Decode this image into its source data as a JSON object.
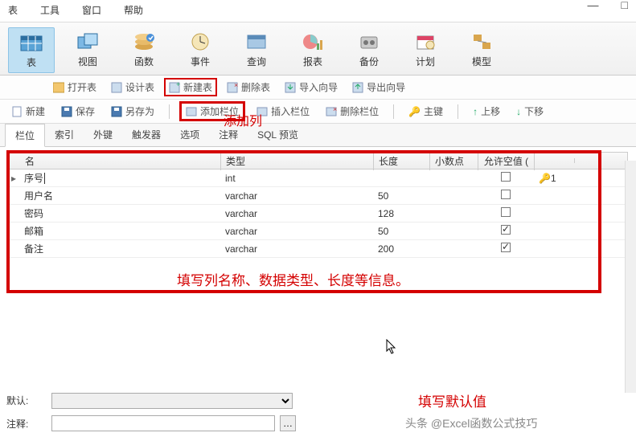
{
  "menu": {
    "items": [
      "表",
      "工具",
      "窗口",
      "帮助"
    ]
  },
  "ribbon": {
    "items": [
      {
        "label": "表",
        "selected": true
      },
      {
        "label": "视图"
      },
      {
        "label": "函数"
      },
      {
        "label": "事件"
      },
      {
        "label": "查询"
      },
      {
        "label": "报表"
      },
      {
        "label": "备份"
      },
      {
        "label": "计划"
      },
      {
        "label": "模型"
      }
    ]
  },
  "toolbar1": {
    "open": "打开表",
    "design": "设计表",
    "newtable": "新建表",
    "deltable": "删除表",
    "import": "导入向导",
    "export": "导出向导"
  },
  "annotations": {
    "add_column": "添加列",
    "fill_info": "填写列名称、数据类型、长度等信息。",
    "fill_default": "填写默认值",
    "watermark": "头条 @Excel函数公式技巧"
  },
  "toolbar2": {
    "new": "新建",
    "save": "保存",
    "saveas": "另存为",
    "addfield": "添加栏位",
    "insertfield": "插入栏位",
    "delfield": "删除栏位",
    "pk": "主键",
    "moveup": "上移",
    "movedown": "下移"
  },
  "tabs": [
    "栏位",
    "索引",
    "外键",
    "触发器",
    "选项",
    "注释",
    "SQL 预览"
  ],
  "grid": {
    "headers": {
      "name": "名",
      "type": "类型",
      "length": "长度",
      "decimals": "小数点",
      "allownull": "允许空值 ("
    },
    "rows": [
      {
        "name": "序号",
        "type": "int",
        "length": "",
        "decimals": "",
        "null": false,
        "pk": "1",
        "editing": true
      },
      {
        "name": "用户名",
        "type": "varchar",
        "length": "50",
        "decimals": "",
        "null": false
      },
      {
        "name": "密码",
        "type": "varchar",
        "length": "128",
        "decimals": "",
        "null": false
      },
      {
        "name": "邮箱",
        "type": "varchar",
        "length": "50",
        "decimals": "",
        "null": true
      },
      {
        "name": "备注",
        "type": "varchar",
        "length": "200",
        "decimals": "",
        "null": true
      }
    ]
  },
  "form": {
    "default_label": "默认:",
    "comment_label": "注释:"
  }
}
